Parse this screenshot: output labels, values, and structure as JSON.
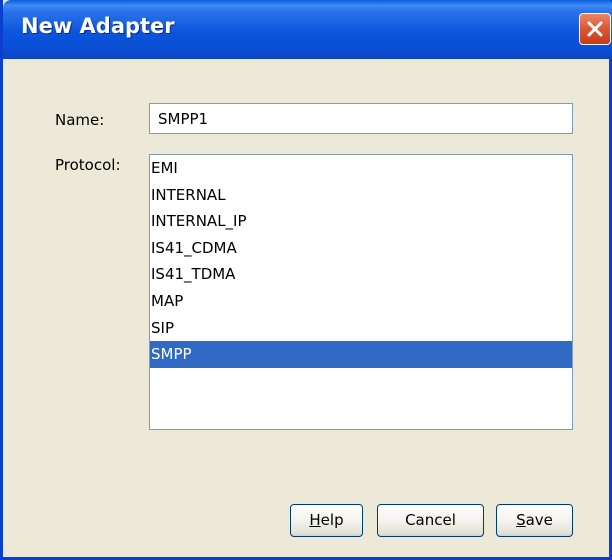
{
  "window": {
    "title": "New Adapter",
    "close_icon": "close-icon"
  },
  "form": {
    "name_label": "Name:",
    "name_value": "SMPP1",
    "protocol_label": "Protocol:",
    "protocol_options": [
      "EMI",
      "INTERNAL",
      "INTERNAL_IP",
      "IS41_CDMA",
      "IS41_TDMA",
      "MAP",
      "SIP",
      "SMPP"
    ],
    "selected_protocol": "SMPP"
  },
  "buttons": {
    "help": {
      "mnemonic": "H",
      "rest": "elp"
    },
    "cancel": {
      "label": "Cancel"
    },
    "save": {
      "mnemonic": "S",
      "rest": "ave"
    }
  },
  "colors": {
    "titlebar": "#0b55dd",
    "close_button": "#dc5a36",
    "selection": "#316ac5",
    "dialog_background": "#ece9d8"
  }
}
